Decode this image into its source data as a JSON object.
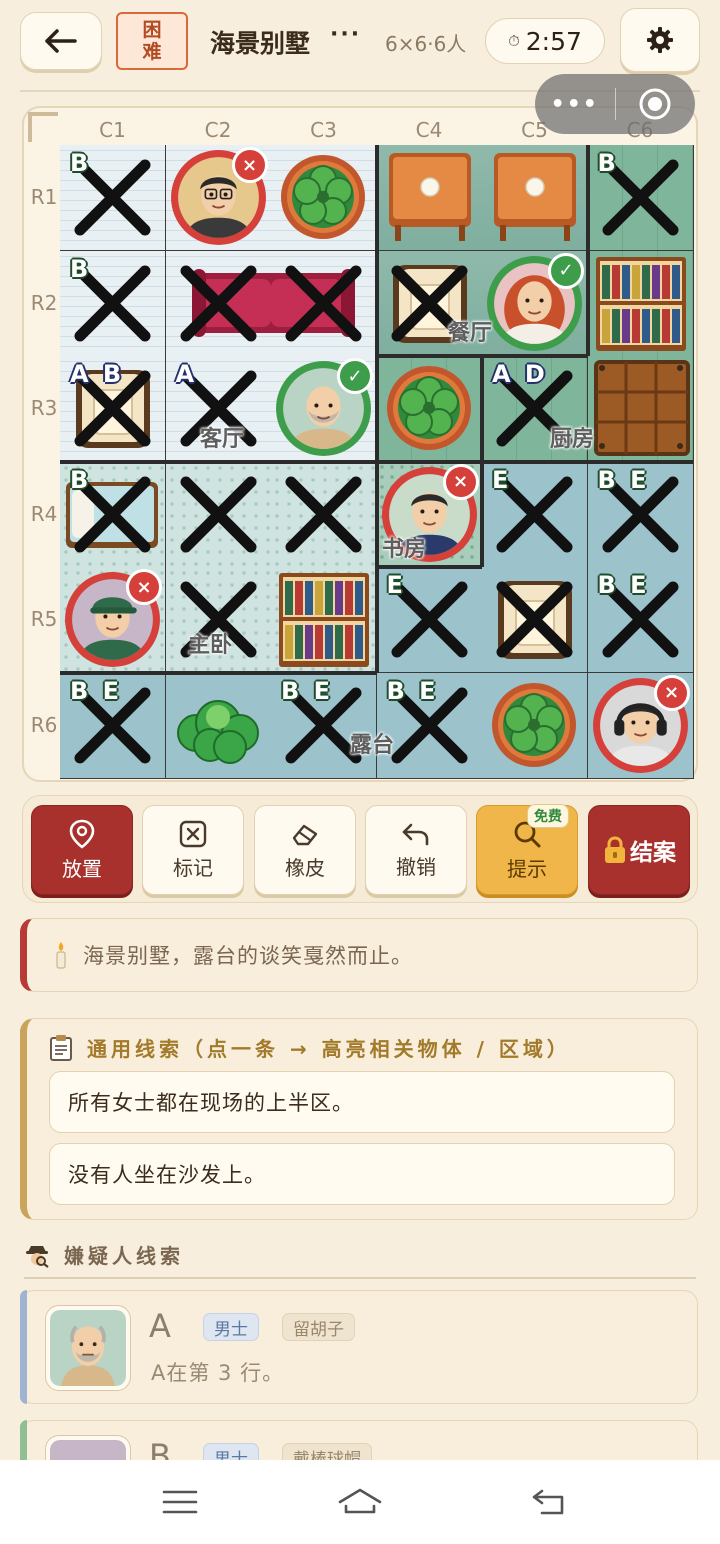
{
  "header": {
    "back_icon": "back-arrow-icon",
    "difficulty": "困难",
    "title": "海景别墅",
    "more": "···",
    "grid_info": "6×6·6人",
    "timer_icon": "stopwatch-icon",
    "timer": "2:57",
    "settings_icon": "gear-icon"
  },
  "board": {
    "columns": [
      "C1",
      "C2",
      "C3",
      "C4",
      "C5",
      "C6"
    ],
    "rows": [
      "R1",
      "R2",
      "R3",
      "R4",
      "R5",
      "R6"
    ],
    "rooms": [
      "餐厅",
      "客厅",
      "厨房",
      "书房",
      "主卧",
      "露台"
    ],
    "cells": [
      {
        "r": 1,
        "c": 1,
        "bg": "living",
        "obj": "",
        "tag": "B",
        "tagColor": "green",
        "x": true
      },
      {
        "r": 1,
        "c": 2,
        "bg": "living",
        "obj": "portrait-glasses-man",
        "mark": "wrong"
      },
      {
        "r": 1,
        "c": 3,
        "bg": "living",
        "obj": "plant",
        "tag": ""
      },
      {
        "r": 1,
        "c": 4,
        "bg": "dining",
        "obj": "table"
      },
      {
        "r": 1,
        "c": 5,
        "bg": "dining",
        "obj": "table"
      },
      {
        "r": 1,
        "c": 6,
        "bg": "kitchen",
        "obj": "",
        "tag": "B",
        "tagColor": "green",
        "x": true
      },
      {
        "r": 2,
        "c": 1,
        "bg": "living",
        "obj": "",
        "tag": "B",
        "tagColor": "green",
        "x": true
      },
      {
        "r": 2,
        "c": 2,
        "bg": "living",
        "obj": "sofa-left",
        "x": true
      },
      {
        "r": 2,
        "c": 3,
        "bg": "living",
        "obj": "sofa-right",
        "x": true
      },
      {
        "r": 2,
        "c": 4,
        "bg": "dining",
        "obj": "chair",
        "x": true
      },
      {
        "r": 2,
        "c": 5,
        "bg": "dining",
        "obj": "portrait-red-hair-woman",
        "mark": "correct"
      },
      {
        "r": 2,
        "c": 6,
        "bg": "kitchen",
        "obj": "bookshelf"
      },
      {
        "r": 3,
        "c": 1,
        "bg": "living",
        "obj": "chair",
        "tag": "A B",
        "tagColor": "blue",
        "x": true
      },
      {
        "r": 3,
        "c": 2,
        "bg": "living",
        "obj": "",
        "tag": "A",
        "tagColor": "blue",
        "x": true
      },
      {
        "r": 3,
        "c": 3,
        "bg": "living",
        "obj": "portrait-bald-beard-man",
        "mark": "correct"
      },
      {
        "r": 3,
        "c": 4,
        "bg": "kitchen",
        "obj": "plant"
      },
      {
        "r": 3,
        "c": 5,
        "bg": "kitchen",
        "obj": "",
        "tag": "A D",
        "tagColor": "blue",
        "x": true
      },
      {
        "r": 3,
        "c": 6,
        "bg": "kitchen",
        "obj": "crate"
      },
      {
        "r": 4,
        "c": 1,
        "bg": "bedroom",
        "obj": "bed",
        "tag": "B",
        "tagColor": "green",
        "x": true
      },
      {
        "r": 4,
        "c": 2,
        "bg": "bedroom",
        "obj": "",
        "x": true
      },
      {
        "r": 4,
        "c": 3,
        "bg": "bedroom",
        "obj": "",
        "x": true
      },
      {
        "r": 4,
        "c": 4,
        "bg": "study",
        "obj": "portrait-braid-girl",
        "mark": "wrong"
      },
      {
        "r": 4,
        "c": 5,
        "bg": "terrace",
        "obj": "",
        "tag": "E",
        "tagColor": "green",
        "x": true
      },
      {
        "r": 4,
        "c": 6,
        "bg": "terrace",
        "obj": "",
        "tag": "B E",
        "tagColor": "green",
        "x": true
      },
      {
        "r": 5,
        "c": 1,
        "bg": "bedroom",
        "obj": "portrait-cap-man",
        "mark": "wrong"
      },
      {
        "r": 5,
        "c": 2,
        "bg": "bedroom",
        "obj": "",
        "x": true
      },
      {
        "r": 5,
        "c": 3,
        "bg": "bedroom",
        "obj": "bookshelf"
      },
      {
        "r": 5,
        "c": 4,
        "bg": "terrace",
        "obj": "",
        "tag": "E",
        "tagColor": "green",
        "x": true
      },
      {
        "r": 5,
        "c": 5,
        "bg": "terrace",
        "obj": "chair",
        "x": true
      },
      {
        "r": 5,
        "c": 6,
        "bg": "terrace",
        "obj": "",
        "tag": "B E",
        "tagColor": "green",
        "x": true
      },
      {
        "r": 6,
        "c": 1,
        "bg": "terrace",
        "obj": "",
        "tag": "B E",
        "tagColor": "green",
        "x": true
      },
      {
        "r": 6,
        "c": 2,
        "bg": "terrace",
        "obj": "bush"
      },
      {
        "r": 6,
        "c": 3,
        "bg": "terrace",
        "obj": "",
        "tag": "B E",
        "tagColor": "green",
        "x": true
      },
      {
        "r": 6,
        "c": 4,
        "bg": "terrace",
        "obj": "",
        "tag": "B E",
        "tagColor": "green",
        "x": true
      },
      {
        "r": 6,
        "c": 5,
        "bg": "terrace",
        "obj": "plant"
      },
      {
        "r": 6,
        "c": 6,
        "bg": "terrace",
        "obj": "portrait-headphone-man",
        "mark": "wrong"
      }
    ]
  },
  "menu_capsule": {
    "more_icon": "three-dots-icon",
    "close_icon": "record-circle-icon"
  },
  "toolbar": {
    "place": {
      "icon": "location-pin-icon",
      "label": "放置"
    },
    "mark": {
      "icon": "x-box-icon",
      "label": "标记"
    },
    "eraser": {
      "icon": "eraser-icon",
      "label": "橡皮"
    },
    "undo": {
      "icon": "undo-icon",
      "label": "撤销"
    },
    "hint": {
      "icon": "magnifier-icon",
      "label": "提示",
      "badge": "免费"
    },
    "solve": {
      "icon": "lock-icon",
      "label": "结案"
    }
  },
  "narration": {
    "icon": "candle-icon",
    "text": "海景别墅，露台的谈笑戛然而止。"
  },
  "general_clues": {
    "icon": "clipboard-icon",
    "title": "通用线索（点一条 → 高亮相关物体 / 区域）",
    "items": [
      "所有女士都在现场的上半区。",
      "没有人坐在沙发上。"
    ]
  },
  "suspects": {
    "icon": "detective-icon",
    "title": "嫌疑人线索",
    "list": [
      {
        "letter": "A",
        "gender": "男士",
        "trait": "留胡子",
        "clue": "A在第 3 行。",
        "accent": "#9fb3d3"
      },
      {
        "letter": "B",
        "gender": "男士",
        "trait": "戴棒球帽",
        "clue": "",
        "accent": "#8fbf93"
      }
    ]
  },
  "colors": {
    "accent_red": "#a8312d",
    "hint_gold": "#f1b64a",
    "ok_green": "#3e9d4a",
    "wrong_red": "#d5403a"
  }
}
